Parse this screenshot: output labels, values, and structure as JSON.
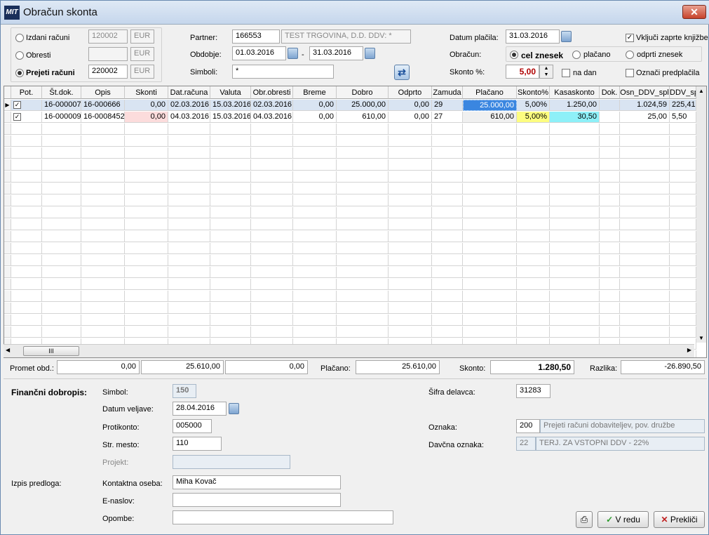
{
  "window": {
    "title": "Obračun skonta"
  },
  "top": {
    "doc_types": [
      {
        "label": "Izdani računi",
        "code": "120002",
        "currency": "EUR",
        "selected": false
      },
      {
        "label": "Obresti",
        "code": "",
        "currency": "EUR",
        "selected": false
      },
      {
        "label": "Prejeti računi",
        "code": "220002",
        "currency": "EUR",
        "selected": true
      }
    ],
    "partner_label": "Partner:",
    "partner_code": "166553",
    "partner_name": "TEST TRGOVINA, D.D. DDV: *",
    "period_label": "Obdobje:",
    "period_from": "01.03.2016",
    "period_sep": "-",
    "period_to": "31.03.2016",
    "symbols_label": "Simboli:",
    "symbols_value": "*",
    "payment_date_label": "Datum plačila:",
    "payment_date": "31.03.2016",
    "calc_label": "Obračun:",
    "calc_options": [
      "cel znesek",
      "plačano",
      "odprti znesek"
    ],
    "skonto_label": "Skonto %:",
    "skonto_value": "5,00",
    "per_day_label": "na dan",
    "include_closed_label": "Vključi zaprte knjižbe",
    "mark_prepay_label": "Označi predplačila"
  },
  "grid": {
    "columns": [
      "Pot.",
      "Št.dok.",
      "Opis",
      "Skonti",
      "Dat.računa",
      "Valuta",
      "Obr.obresti",
      "Breme",
      "Dobro",
      "Odprto",
      "Zamuda",
      "Plačano",
      "Skonto%",
      "Kasaskonto",
      "Dok.",
      "Osn_DDV_spl",
      "DDV_sp"
    ],
    "rows": [
      {
        "pot": "✓",
        "st": "16-000007",
        "opis": "16-000666",
        "skonti": "0,00",
        "dat": "02.03.2016",
        "val": "15.03.2016",
        "obr": "02.03.2016",
        "breme": "0,00",
        "dobro": "25.000,00",
        "odprto": "0,00",
        "zamuda": "29",
        "placano": "25.000,00",
        "sk": "5,00%",
        "kasa": "1.250,00",
        "dok": "",
        "osn": "1.024,59",
        "ddv": "225,41"
      },
      {
        "pot": "✓",
        "st": "16-000009",
        "opis": "16-0008452",
        "skonti": "0,00",
        "dat": "04.03.2016",
        "val": "15.03.2016",
        "obr": "04.03.2016",
        "breme": "0,00",
        "dobro": "610,00",
        "odprto": "0,00",
        "zamuda": "27",
        "placano": "610,00",
        "sk": "5,00%",
        "kasa": "30,50",
        "dok": "",
        "osn": "25,00",
        "ddv": "5,50"
      }
    ],
    "hscroll_label": "III"
  },
  "totals": {
    "promet_label": "Promet obd.:",
    "v1": "0,00",
    "v2": "25.610,00",
    "v3": "0,00",
    "placano_label": "Plačano:",
    "placano": "25.610,00",
    "skonto_label": "Skonto:",
    "skonto": "1.280,50",
    "razlika_label": "Razlika:",
    "razlika": "-26.890,50"
  },
  "fin": {
    "section_label": "Finančni dobropis:",
    "simbol_label": "Simbol:",
    "simbol": "150",
    "datum_label": "Datum veljave:",
    "datum": "28.04.2016",
    "protikonto_label": "Protikonto:",
    "protikonto": "005000",
    "strmesto_label": "Str. mesto:",
    "strmesto": "110",
    "projekt_label": "Projekt:",
    "projekt": "",
    "sifra_label": "Šifra delavca:",
    "sifra": "31283",
    "oznaka_label": "Oznaka:",
    "oznaka_code": "200",
    "oznaka_text": "Prejeti računi dobaviteljev, pov. družbe",
    "davcna_label": "Davčna oznaka:",
    "davcna_code": "22",
    "davcna_text": "TERJ. ZA VSTOPNI DDV - 22%"
  },
  "print": {
    "section_label": "Izpis predloga:",
    "kontakt_label": "Kontaktna oseba:",
    "kontakt": "Miha Kovač",
    "email_label": "E-naslov:",
    "email": "",
    "opombe_label": "Opombe:",
    "opombe": ""
  },
  "buttons": {
    "ok": "V redu",
    "cancel": "Prekliči"
  }
}
